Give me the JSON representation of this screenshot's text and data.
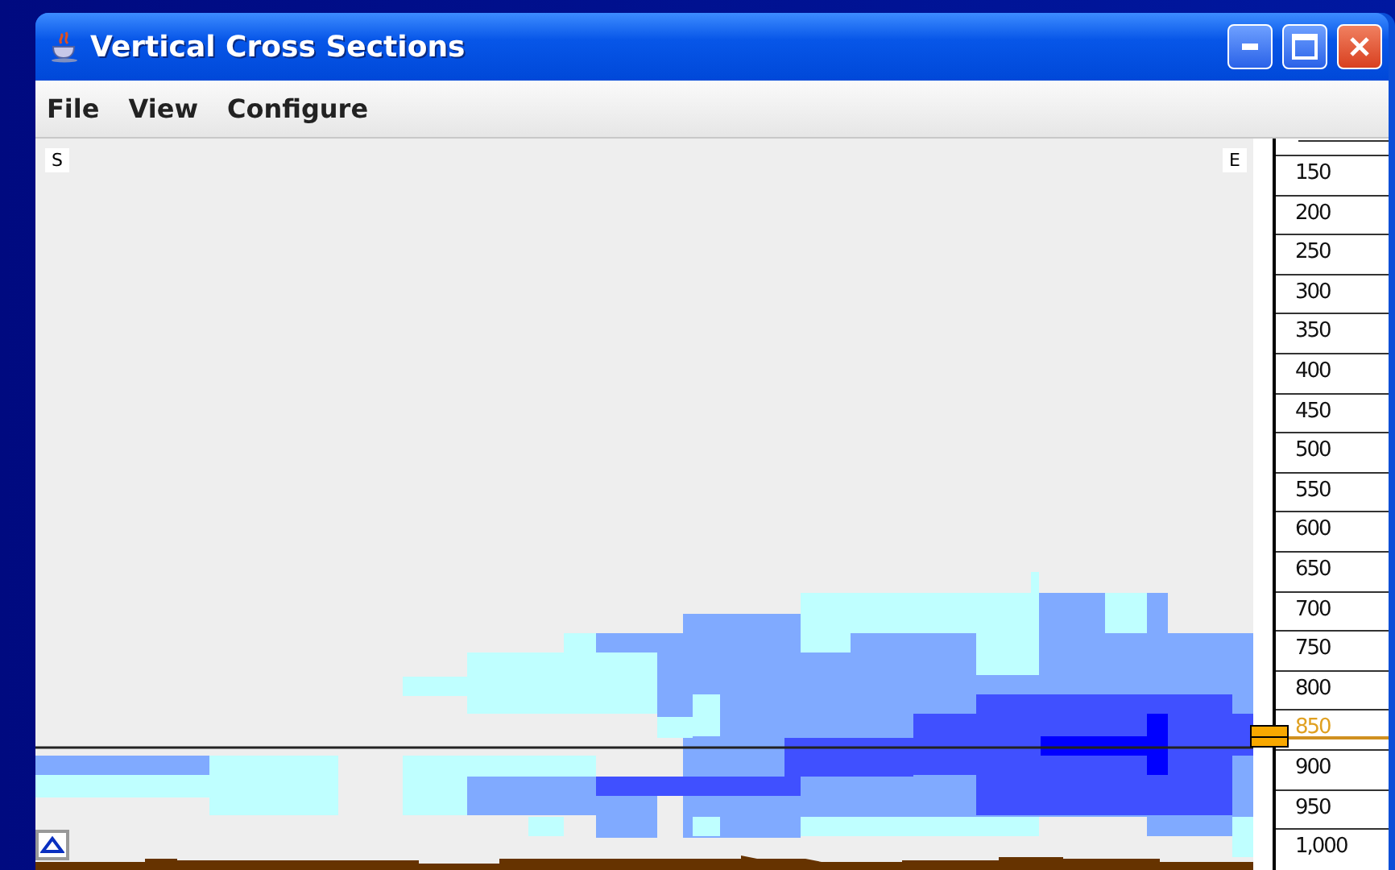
{
  "window": {
    "title": "Vertical Cross Sections"
  },
  "menu": [
    "File",
    "View",
    "Configure"
  ],
  "plot": {
    "left_label": "S",
    "right_label": "E"
  },
  "levels": [
    {
      "label": "150",
      "selected": false
    },
    {
      "label": "200",
      "selected": false
    },
    {
      "label": "250",
      "selected": false
    },
    {
      "label": "300",
      "selected": false
    },
    {
      "label": "350",
      "selected": false
    },
    {
      "label": "400",
      "selected": false
    },
    {
      "label": "450",
      "selected": false
    },
    {
      "label": "500",
      "selected": false
    },
    {
      "label": "550",
      "selected": false
    },
    {
      "label": "600",
      "selected": false
    },
    {
      "label": "650",
      "selected": false
    },
    {
      "label": "700",
      "selected": false
    },
    {
      "label": "750",
      "selected": false
    },
    {
      "label": "800",
      "selected": false
    },
    {
      "label": "850",
      "selected": true
    },
    {
      "label": "900",
      "selected": false
    },
    {
      "label": "950",
      "selected": false
    },
    {
      "label": "1,000",
      "selected": false
    }
  ]
}
